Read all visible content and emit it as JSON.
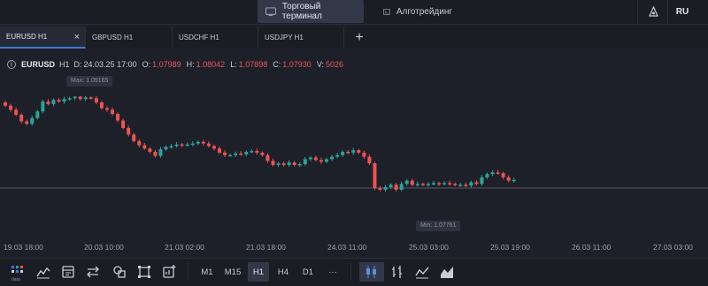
{
  "top_nav": {
    "terminal_label": "Торговый терминал",
    "algo_label": "Алготрейдинг",
    "lang_label": "RU"
  },
  "tabs": [
    {
      "label": "EURUSD H1",
      "active": true,
      "close": "×"
    },
    {
      "label": "GBPUSD H1"
    },
    {
      "label": "USDCHF H1"
    },
    {
      "label": "USDJPY H1"
    }
  ],
  "add_tab_label": "+",
  "ohlc": {
    "symbol": "EURUSD",
    "timeframe": "H1",
    "date_label": "D:",
    "date": "24.03.25 17:00",
    "open_label": "O:",
    "open": "1.07989",
    "high_label": "H:",
    "high": "1.08042",
    "low_label": "L:",
    "low": "1.07898",
    "close_label": "C:",
    "close": "1.07930",
    "volume_label": "V:",
    "volume": "5026"
  },
  "chart": {
    "max_label": "Max: 1.09165",
    "min_label": "Min: 1.07761",
    "up_color": "#26a69a",
    "down_color": "#ef5350"
  },
  "x_axis": [
    "19.03 18:00",
    "20.03 10:00",
    "21.03 02:00",
    "21.03 18:00",
    "24.03 11:00",
    "25.03 03:00",
    "25.03 19:00",
    "26.03 11:00",
    "27.03 03:00"
  ],
  "toolbar": {
    "data_caption": "data",
    "timeframes": [
      "M1",
      "M15",
      "H1",
      "H4",
      "D1"
    ],
    "active_timeframe": "H1",
    "more_label": "···"
  },
  "chart_data": {
    "type": "candlestick",
    "symbol": "EURUSD",
    "timeframe": "H1",
    "max": 1.09165,
    "min": 1.07761,
    "last_candle": {
      "date": "24.03.25 17:00",
      "open": 1.07989,
      "high": 1.08042,
      "low": 1.07898,
      "close": 1.0793,
      "volume": 5026
    },
    "x_tick_labels": [
      "19.03 18:00",
      "20.03 10:00",
      "21.03 02:00",
      "21.03 18:00",
      "24.03 11:00",
      "25.03 03:00",
      "25.03 19:00",
      "26.03 11:00",
      "27.03 03:00"
    ],
    "approx_closes": [
      1.0905,
      1.09,
      1.0894,
      1.0886,
      1.0883,
      1.089,
      1.0898,
      1.091,
      1.0907,
      1.0912,
      1.091,
      1.0913,
      1.0914,
      1.0916,
      1.0913,
      1.0915,
      1.0914,
      1.0909,
      1.0902,
      1.09,
      1.0895,
      1.0887,
      1.0878,
      1.087,
      1.0862,
      1.0857,
      1.0853,
      1.0849,
      1.0844,
      1.0852,
      1.0855,
      1.0856,
      1.0858,
      1.0857,
      1.0858,
      1.0859,
      1.0861,
      1.0859,
      1.0856,
      1.0853,
      1.0848,
      1.0845,
      1.0845,
      1.0847,
      1.0846,
      1.0849,
      1.085,
      1.0848,
      1.0845,
      1.0838,
      1.0833,
      1.0835,
      1.0833,
      1.0836,
      1.0833,
      1.0834,
      1.084,
      1.0842,
      1.0839,
      1.0837,
      1.084,
      1.0843,
      1.0845,
      1.0849,
      1.0848,
      1.0851,
      1.0848,
      1.0843,
      1.0835,
      1.0805,
      1.0803,
      1.0806,
      1.0809,
      1.0803,
      1.081,
      1.0814,
      1.0809,
      1.081,
      1.0809,
      1.081,
      1.0811,
      1.081,
      1.0811,
      1.081,
      1.0809,
      1.0809,
      1.0808,
      1.0812,
      1.081,
      1.0818,
      1.0822,
      1.0824,
      1.0823,
      1.0818,
      1.0814,
      1.0815
    ]
  }
}
